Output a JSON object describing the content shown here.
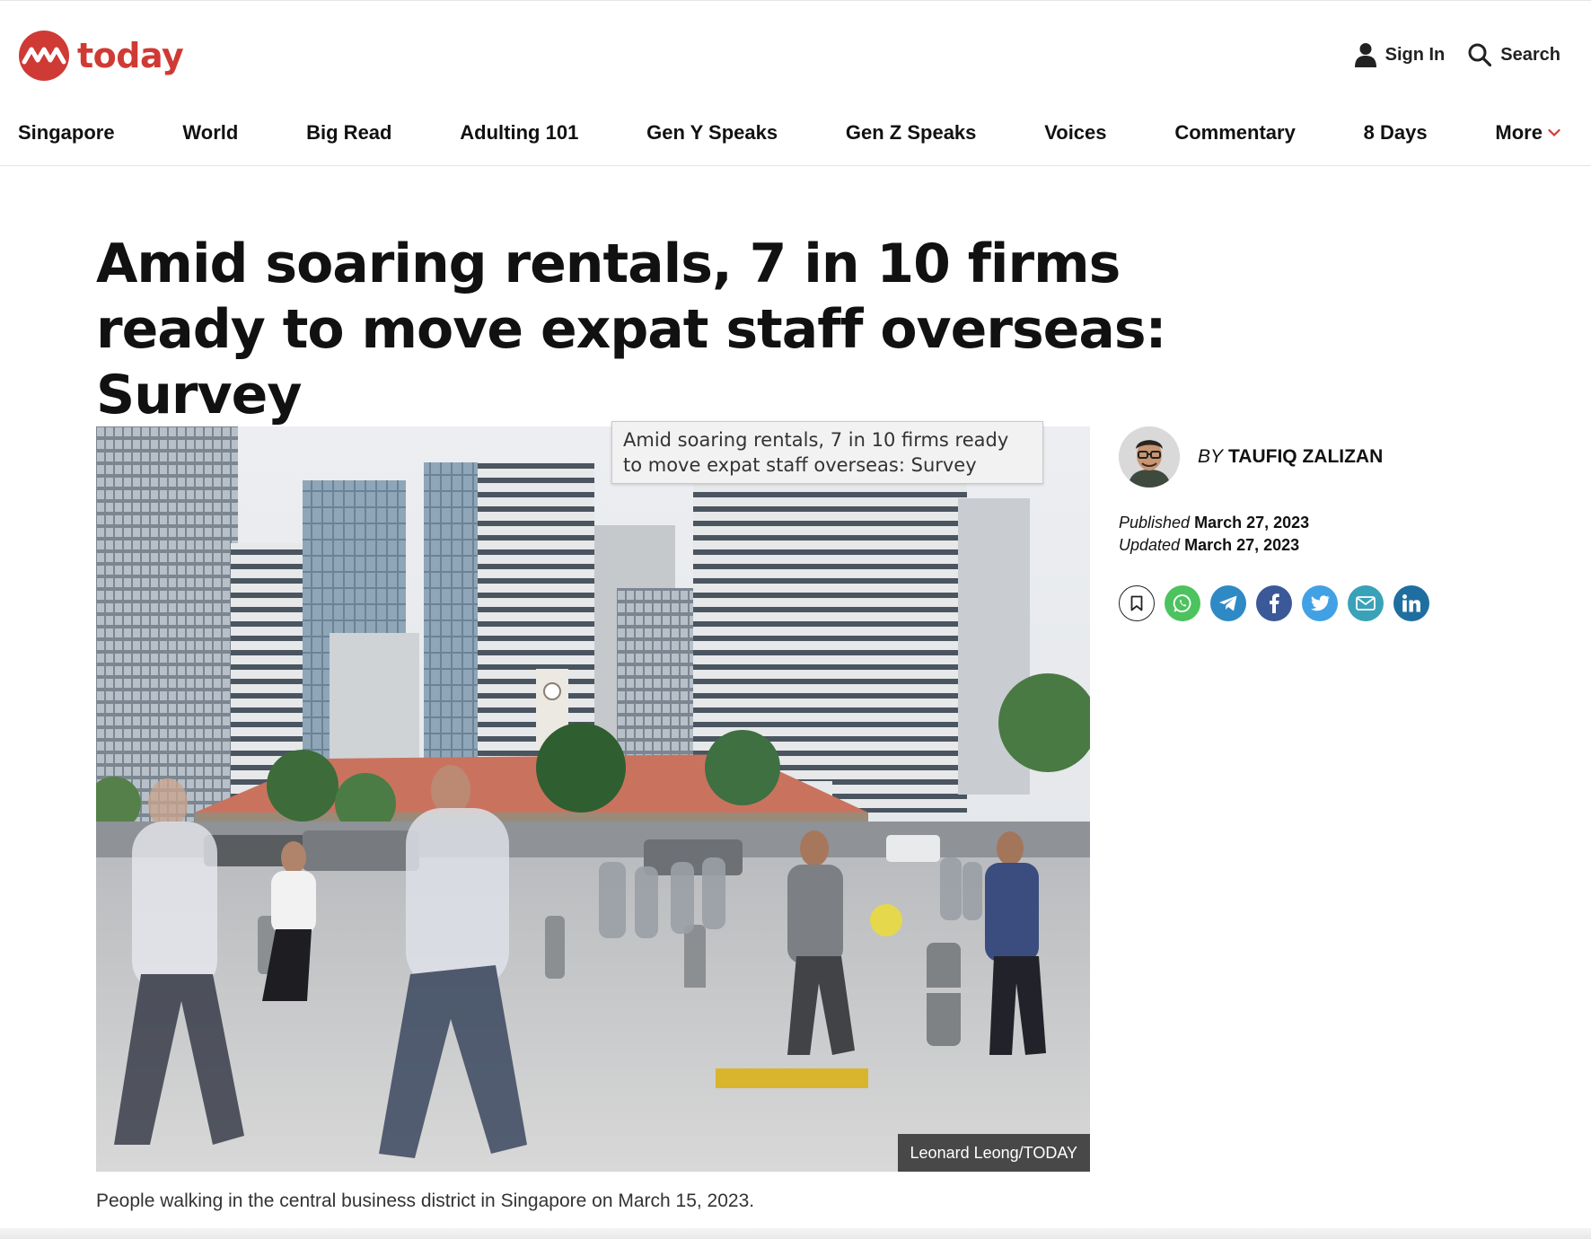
{
  "site": {
    "logo_text": "today",
    "brand_color": "#cf3a35"
  },
  "header": {
    "signin_label": "Sign In",
    "search_label": "Search",
    "signin_icon": "user-icon",
    "search_icon": "search-icon"
  },
  "nav": {
    "items": [
      "Singapore",
      "World",
      "Big Read",
      "Adulting 101",
      "Gen Y Speaks",
      "Gen Z Speaks",
      "Voices",
      "Commentary",
      "8 Days"
    ],
    "more_label": "More"
  },
  "article": {
    "headline": "Amid soaring rentals, 7 in 10 firms ready to move expat staff overseas: Survey",
    "tooltip": "Amid soaring rentals, 7 in 10 firms ready to move expat staff overseas: Survey",
    "image_credit": "Leonard Leong/TODAY",
    "caption": "People walking in the central business district in Singapore on March 15, 2023."
  },
  "author": {
    "by_label": "BY",
    "name": "TAUFIQ ZALIZAN"
  },
  "dates": {
    "published_label": "Published",
    "published_value": "March 27, 2023",
    "updated_label": "Updated",
    "updated_value": "March 27, 2023"
  },
  "share": {
    "buttons": [
      {
        "icon": "bookmark-icon",
        "color": "#ffffff"
      },
      {
        "icon": "whatsapp-icon",
        "color": "#4cc35e"
      },
      {
        "icon": "telegram-icon",
        "color": "#2f89c5"
      },
      {
        "icon": "facebook-icon",
        "color": "#3b5998"
      },
      {
        "icon": "twitter-icon",
        "color": "#41a1e4"
      },
      {
        "icon": "email-icon",
        "color": "#3aa2b8"
      },
      {
        "icon": "linkedin-icon",
        "color": "#1f6ea0"
      }
    ]
  }
}
